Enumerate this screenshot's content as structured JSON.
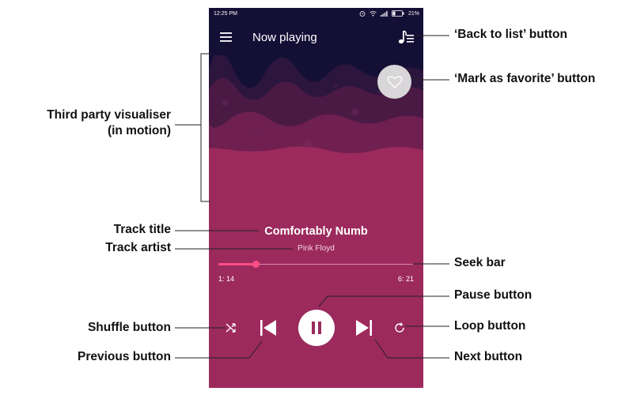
{
  "status_bar": {
    "time": "12:25 PM",
    "battery": "21%",
    "icons": [
      "alarm-icon",
      "wifi-icon",
      "signal-icon",
      "battery-icon"
    ]
  },
  "app_bar": {
    "title": "Now playing",
    "menu_icon": "hamburger-menu-icon",
    "list_icon": "music-list-icon"
  },
  "favorite": {
    "icon": "heart-icon"
  },
  "track": {
    "title": "Comfortably Numb",
    "artist": "Pink Floyd"
  },
  "seek": {
    "elapsed": "1: 14",
    "total": "6: 21",
    "progress_fraction": 0.19
  },
  "controls": {
    "shuffle_icon": "shuffle-icon",
    "previous_icon": "skip-previous-icon",
    "pause_icon": "pause-icon",
    "next_icon": "skip-next-icon",
    "loop_icon": "loop-icon"
  },
  "colors": {
    "app_bar": "#140f35",
    "background": "#9c2a5d",
    "accent": "#ff4d86"
  },
  "annotations": {
    "back_to_list": "‘Back to list’ button",
    "mark_favorite": "‘Mark as favorite’ button",
    "visualiser_line1": "Third party visualiser",
    "visualiser_line2": "(in motion)",
    "track_title": "Track title",
    "track_artist": "Track artist",
    "seek_bar": "Seek bar",
    "pause_button": "Pause button",
    "shuffle_button": "Shuffle button",
    "loop_button": "Loop button",
    "previous_button": "Previous button",
    "next_button": "Next button"
  }
}
